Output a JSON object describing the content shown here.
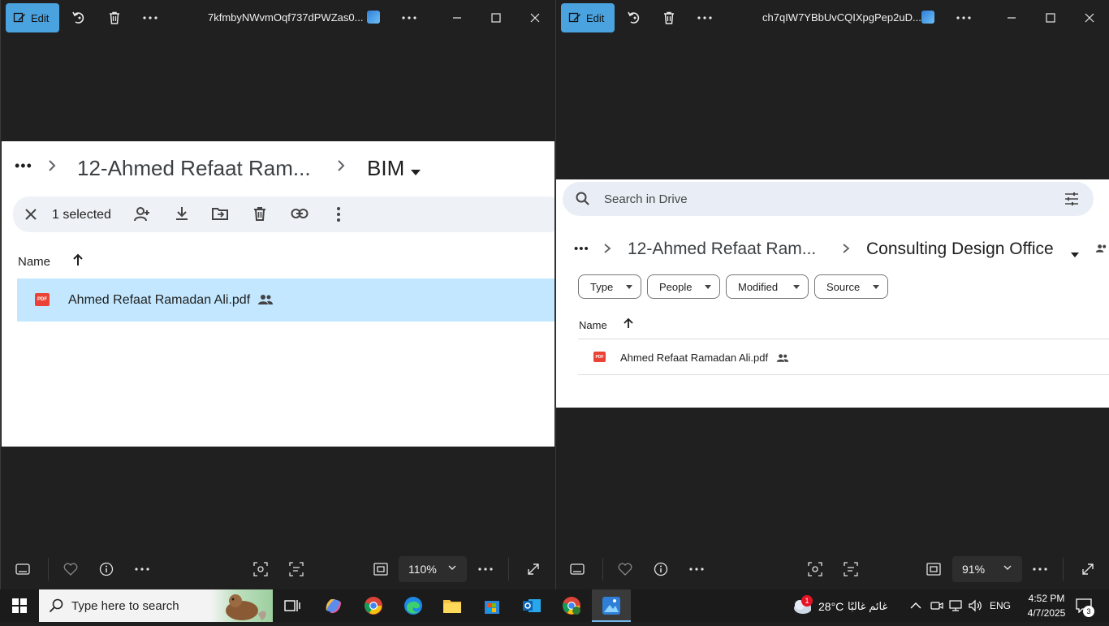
{
  "left_window": {
    "edit_label": "Edit",
    "title": "7kfmbyNWvmOqf737dPWZas0...",
    "breadcrumb": {
      "more": "•••",
      "parent": "12-Ahmed Refaat Ram...",
      "current": "BIM"
    },
    "selection": {
      "count_label": "1 selected"
    },
    "list_header": {
      "name": "Name"
    },
    "file": {
      "name": "Ahmed Refaat Ramadan Ali.pdf",
      "icon_text": "PDF"
    },
    "zoom": "110%"
  },
  "right_window": {
    "edit_label": "Edit",
    "title": "ch7qIW7YBbUvCQIXpgPep2uD...",
    "search_placeholder": "Search in Drive",
    "breadcrumb": {
      "more": "•••",
      "parent": "12-Ahmed Refaat Ram...",
      "current": "Consulting Design Office"
    },
    "filters": [
      "Type",
      "People",
      "Modified",
      "Source"
    ],
    "list_header": {
      "name": "Name"
    },
    "file": {
      "name": "Ahmed Refaat Ramadan Ali.pdf",
      "icon_text": "PDF"
    },
    "zoom": "91%"
  },
  "taskbar": {
    "search_placeholder": "Type here to search",
    "weather_temp": "28°C",
    "weather_text": "غائم غالبًا",
    "weather_badge": "1",
    "language": "ENG",
    "time": "4:52 PM",
    "date": "4/7/2025",
    "notifications": "3"
  }
}
